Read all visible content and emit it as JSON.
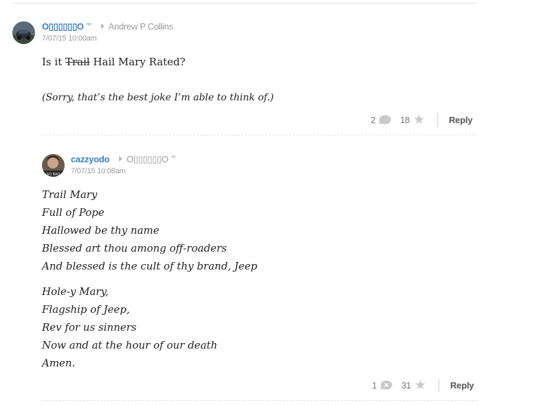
{
  "comments": [
    {
      "author": "O▯▯▯▯▯▯O",
      "trademark": "™",
      "reply_to": "Andrew P Collins",
      "timestamp": "7/07/15 10:00am",
      "body_prefix": "Is it ",
      "body_struck": "Trail",
      "body_suffix": " Hail Mary Rated?",
      "body_note": "(Sorry, that’s the best joke I’m able to think of.)",
      "reply_count": "2",
      "star_count": "18",
      "reply_label": "Reply"
    },
    {
      "author": "cazzyodo",
      "reply_to": "O▯▯▯▯▯▯O",
      "reply_to_trademark": "™",
      "timestamp": "7/07/15 10:08am",
      "stanza1": [
        "Trail Mary",
        "Full of Pope",
        "Hallowed be thy name",
        "Blessed art thou among off-roaders",
        "And blessed is the cult of thy brand, Jeep"
      ],
      "stanza2": [
        "Hole-y Mary,",
        "Flagship of Jeep,",
        "Rev for us sinners",
        "Now and at the hour of our death",
        "Amen."
      ],
      "reply_count": "1",
      "star_count": "31",
      "reply_label": "Reply"
    }
  ],
  "colors": {
    "link": "#3b7fc4",
    "muted": "#9a9a9a",
    "icon": "#c9c9c9"
  },
  "icons": [
    "comment-bubble-icon",
    "star-icon",
    "reply-arrow-icon"
  ]
}
